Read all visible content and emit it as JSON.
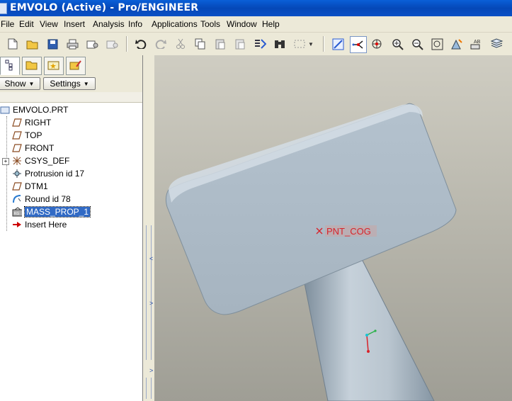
{
  "window": {
    "title": "EMVOLO (Active) - Pro/ENGINEER"
  },
  "menu": [
    "File",
    "Edit",
    "View",
    "Insert",
    "Analysis",
    "Info",
    "Applications",
    "Tools",
    "Window",
    "Help"
  ],
  "panel": {
    "show_label": "Show",
    "settings_label": "Settings"
  },
  "tree": {
    "root": "EMVOLO.PRT",
    "items": [
      {
        "label": "RIGHT",
        "icon": "datum-plane-icon"
      },
      {
        "label": "TOP",
        "icon": "datum-plane-icon"
      },
      {
        "label": "FRONT",
        "icon": "datum-plane-icon"
      },
      {
        "label": "CSYS_DEF",
        "icon": "csys-icon"
      },
      {
        "label": "Protrusion id 17",
        "icon": "protrusion-icon"
      },
      {
        "label": "DTM1",
        "icon": "datum-plane-icon"
      },
      {
        "label": "Round id 78",
        "icon": "round-icon"
      },
      {
        "label": "MASS_PROP_1",
        "icon": "analysis-icon",
        "selected": true
      },
      {
        "label": "Insert Here",
        "icon": "insert-arrow-icon"
      }
    ]
  },
  "viewport": {
    "point_label": "PNT_COG",
    "background_top": "#cfcdc2",
    "background_bottom": "#9f9e95",
    "model_color": "#a9b7c3"
  }
}
